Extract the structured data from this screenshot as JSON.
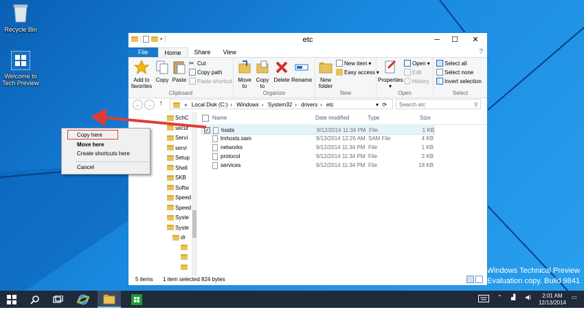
{
  "desktop": {
    "icons": [
      {
        "label": "Recycle Bin"
      },
      {
        "label_line1": "Welcome to",
        "label_line2": "Tech Preview"
      }
    ],
    "watermark": {
      "line1": "Windows Technical Preview",
      "line2": "Evaluation copy. Build 9841"
    }
  },
  "window": {
    "title": "etc",
    "tabs": [
      "File",
      "Home",
      "Share",
      "View"
    ],
    "help_glyph": "?",
    "ribbon": {
      "clipboard": {
        "label": "Clipboard",
        "add_to_favorites": "Add to favorites",
        "copy": "Copy",
        "paste": "Paste",
        "cut": "Cut",
        "copy_path": "Copy path",
        "paste_shortcut": "Paste shortcut"
      },
      "organize": {
        "label": "Organize",
        "move_to": "Move to",
        "copy_to": "Copy to",
        "delete": "Delete",
        "rename": "Rename"
      },
      "new": {
        "label": "New",
        "new_folder": "New folder",
        "new_item": "New item",
        "easy_access": "Easy access"
      },
      "open": {
        "label": "Open",
        "properties": "Properties",
        "open": "Open",
        "edit": "Edit",
        "history": "History"
      },
      "select": {
        "label": "Select",
        "select_all": "Select all",
        "select_none": "Select none",
        "invert_selection": "Invert selection"
      }
    },
    "address": {
      "prefix": "«",
      "crumbs": [
        "Local Disk (C:)",
        "Windows",
        "System32",
        "drivers",
        "etc"
      ],
      "search_placeholder": "Search etc"
    },
    "nav_items": [
      "SchC",
      "secur",
      "Servi",
      "servi",
      "Setup",
      "Shell",
      "SKB",
      "Softw",
      "Speed",
      "Speed",
      "Syste",
      "Syste",
      "dr",
      "",
      "",
      ""
    ],
    "columns": {
      "name": "Name",
      "date": "Date modified",
      "type": "Type",
      "size": "Size"
    },
    "files": [
      {
        "name": "hosts",
        "date": "9/12/2014 11:34 PM",
        "type": "File",
        "size": "1 KB",
        "selected": true
      },
      {
        "name": "lmhosts.sam",
        "date": "9/13/2014 12:26 AM",
        "type": "SAM File",
        "size": "4 KB",
        "selected": false
      },
      {
        "name": "networks",
        "date": "9/12/2014 11:34 PM",
        "type": "File",
        "size": "1 KB",
        "selected": false
      },
      {
        "name": "protocol",
        "date": "9/12/2014 11:34 PM",
        "type": "File",
        "size": "2 KB",
        "selected": false
      },
      {
        "name": "services",
        "date": "9/12/2014 11:34 PM",
        "type": "File",
        "size": "18 KB",
        "selected": false
      }
    ],
    "status": {
      "items": "5 items",
      "selection": "1 item selected  824 bytes"
    }
  },
  "context_menu": {
    "items": [
      "Copy here",
      "Move here",
      "Create shortcuts here",
      "Cancel"
    ]
  },
  "taskbar": {
    "clock_time": "2:01 AM",
    "clock_date": "12/13/2014"
  },
  "colors": {
    "accent": "#1979ca",
    "highlight_box": "#e03c36",
    "arrow": "#e03c36"
  }
}
